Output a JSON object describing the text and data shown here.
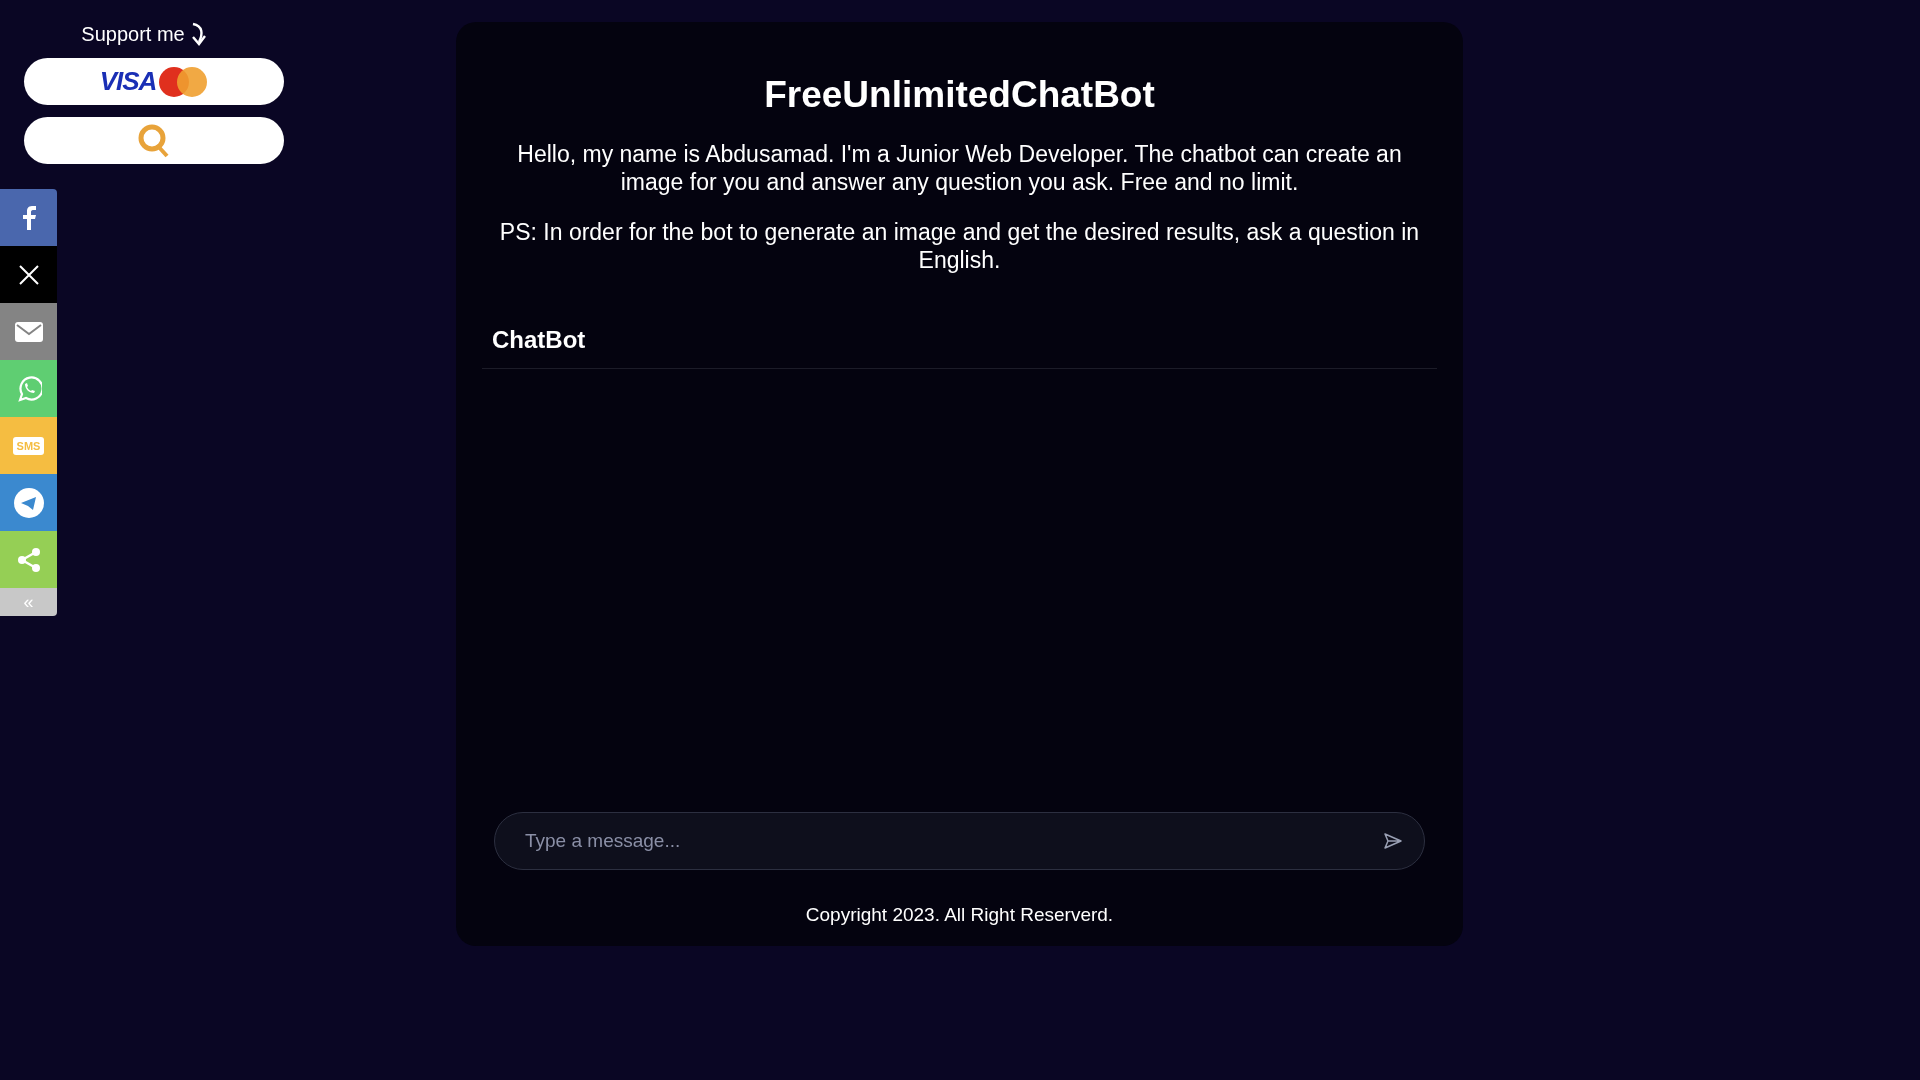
{
  "support": {
    "title": "Support me",
    "buttons": [
      {
        "kind": "card",
        "logo_text": "VISA"
      },
      {
        "kind": "qiwi"
      }
    ]
  },
  "share_bar": {
    "items": [
      {
        "kind": "facebook",
        "color": "#4a67ad"
      },
      {
        "kind": "x",
        "color": "#000000"
      },
      {
        "kind": "email",
        "color": "#848484"
      },
      {
        "kind": "whatsapp",
        "color": "#5fce72"
      },
      {
        "kind": "sms",
        "color": "#f5bd41",
        "icon_text": "SMS"
      },
      {
        "kind": "telegram",
        "color": "#3b89cf"
      },
      {
        "kind": "share",
        "color": "#95cf55"
      }
    ],
    "collapse": "«"
  },
  "main": {
    "title": "FreeUnlimitedChatBot",
    "paragraphs": [
      "Hello, my name is Abdusamad. I'm a Junior Web Developer. The chatbot can create an image for you and answer any question you ask. Free and no limit.",
      "PS: In order for the bot to generate an image and get the desired results, ask a question in English."
    ],
    "chat": {
      "label": "ChatBot",
      "placeholder": "Type a message..."
    },
    "footer": "Copyright 2023. All Right Reserverd."
  }
}
